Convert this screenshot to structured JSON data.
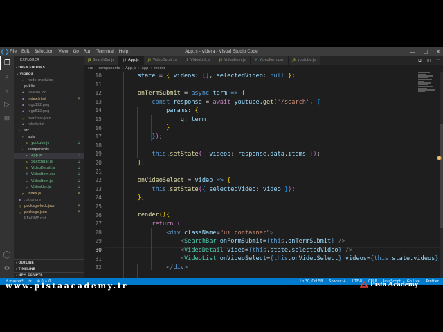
{
  "titlebar": {
    "menu": [
      "File",
      "Edit",
      "Selection",
      "View",
      "Go",
      "Run",
      "Terminal",
      "Help"
    ],
    "window_title": "App.js - videra - Visual Studio Code",
    "controls": [
      "—",
      "□",
      "✕"
    ]
  },
  "activity_bar": {
    "icons": [
      "files-icon",
      "search-icon",
      "source-control-icon",
      "run-debug-icon",
      "extensions-icon"
    ],
    "bottom_icons": [
      "account-icon",
      "settings-gear-icon"
    ]
  },
  "sidebar": {
    "header": "EXPLORER",
    "sections": {
      "open_editors": "OPEN EDITORS",
      "workspace": "VIDEOS",
      "outline": "OUTLINE",
      "timeline": "TIMELINE",
      "npm": "NPM SCRIPTS"
    },
    "tree": [
      {
        "label": "node_modules",
        "status": ""
      },
      {
        "label": "public",
        "status": ""
      },
      {
        "label": "favicon.ico",
        "status": ""
      },
      {
        "label": "index.html",
        "status": "M"
      },
      {
        "label": "logo192.png",
        "status": ""
      },
      {
        "label": "logo512.png",
        "status": ""
      },
      {
        "label": "manifest.json",
        "status": ""
      },
      {
        "label": "robots.txt",
        "status": ""
      },
      {
        "label": "src",
        "status": ""
      },
      {
        "label": "apis",
        "status": ""
      },
      {
        "label": "youtube.js",
        "status": "U"
      },
      {
        "label": "components",
        "status": ""
      },
      {
        "label": "App.js",
        "status": "U"
      },
      {
        "label": "SearchBar.js",
        "status": "U"
      },
      {
        "label": "VideoDetail.js",
        "status": "U"
      },
      {
        "label": "VideoItem.css",
        "status": "U"
      },
      {
        "label": "VideoItem.js",
        "status": "U"
      },
      {
        "label": "VideoList.js",
        "status": "U"
      },
      {
        "label": "index.js",
        "status": "M"
      },
      {
        "label": ".gitignore",
        "status": ""
      },
      {
        "label": "package-lock.json",
        "status": "M"
      },
      {
        "label": "package.json",
        "status": "M"
      },
      {
        "label": "README.md",
        "status": ""
      }
    ]
  },
  "tabs": [
    {
      "label": "SearchBar.js",
      "kind": "js"
    },
    {
      "label": "App.js",
      "kind": "js"
    },
    {
      "label": "VideoDetail.js",
      "kind": "js"
    },
    {
      "label": "VideoList.js",
      "kind": "js"
    },
    {
      "label": "VideoItem.js",
      "kind": "js"
    },
    {
      "label": "VideoItem.css",
      "kind": "css"
    },
    {
      "label": "youtube.js",
      "kind": "js"
    }
  ],
  "tab_actions": [
    "⧉",
    "◫",
    "···"
  ],
  "breadcrumb": [
    "src",
    "components",
    "App.js",
    "App",
    "render"
  ],
  "editor": {
    "line_numbers": [
      "10",
      "11",
      "12",
      "13",
      "14",
      "15",
      "16",
      "17",
      "18",
      "19",
      "20",
      "21",
      "22",
      "23",
      "24",
      "25",
      "26",
      "27",
      "28",
      "29",
      "30",
      "31",
      "32"
    ]
  },
  "statusbar": {
    "left": [
      "⎇ master*",
      "⟳",
      "⊗ 0 ⚠ 0"
    ],
    "right": [
      "Ln 30, Col 58",
      "Spaces: 4",
      "UTF-8",
      "CRLF",
      "JavaScript",
      "Go Live",
      "Prettier"
    ]
  },
  "watermark": {
    "left": "www.pistaacademy.ir",
    "right": "Pista Academy"
  }
}
